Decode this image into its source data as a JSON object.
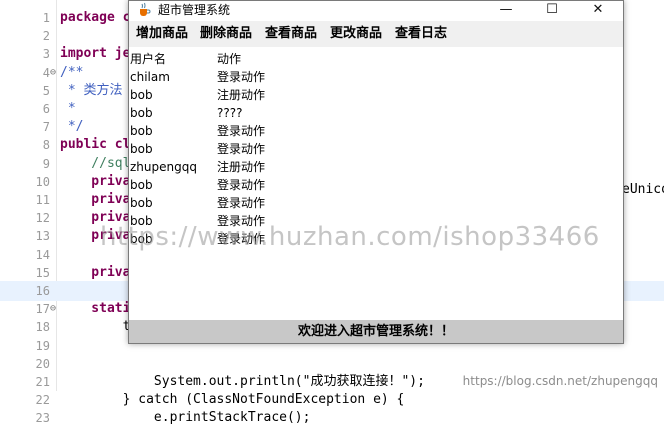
{
  "editor": {
    "lines": [
      {
        "num": "1",
        "fold": "",
        "text": "package c"
      },
      {
        "num": "2",
        "fold": "",
        "text": ""
      },
      {
        "num": "3",
        "fold": "",
        "text": "import je"
      },
      {
        "num": "4",
        "fold": "⊖",
        "text": "/**"
      },
      {
        "num": "5",
        "fold": "",
        "text": " * 类方法"
      },
      {
        "num": "6",
        "fold": "",
        "text": " *"
      },
      {
        "num": "7",
        "fold": "",
        "text": " */"
      },
      {
        "num": "8",
        "fold": "",
        "text": "public cl"
      },
      {
        "num": "9",
        "fold": "",
        "text": "    //sql"
      },
      {
        "num": "10",
        "fold": "",
        "text": "    priva"
      },
      {
        "num": "11",
        "fold": "",
        "text": "    priva"
      },
      {
        "num": "12",
        "fold": "",
        "text": "    priva"
      },
      {
        "num": "13",
        "fold": "",
        "text": "    priva"
      },
      {
        "num": "14",
        "fold": "",
        "text": ""
      },
      {
        "num": "15",
        "fold": "",
        "text": "    priva"
      },
      {
        "num": "16",
        "fold": "",
        "text": ""
      },
      {
        "num": "17",
        "fold": "⊖",
        "text": "    stati"
      },
      {
        "num": "18",
        "fold": "",
        "text": "        t"
      },
      {
        "num": "19",
        "fold": "",
        "text": ""
      },
      {
        "num": "20",
        "fold": "",
        "text": ""
      },
      {
        "num": "21",
        "fold": "",
        "text": "            System.out.println(\"成功获取连接！\");"
      },
      {
        "num": "22",
        "fold": "",
        "text": "        } catch (ClassNotFoundException e) {"
      },
      {
        "num": "23",
        "fold": "",
        "text": "            e.printStackTrace();"
      }
    ],
    "right_fragment": "eUnico"
  },
  "window": {
    "title": "超市管理系统",
    "minimize_glyph": "—",
    "maximize_glyph": "☐",
    "close_glyph": "✕",
    "menu": [
      "增加商品",
      "删除商品",
      "查看商品",
      "更改商品",
      "查看日志"
    ],
    "log_header": {
      "user": "用户名",
      "action": "动作"
    },
    "log_rows": [
      {
        "user": "chilam",
        "action": "登录动作"
      },
      {
        "user": "bob",
        "action": "注册动作"
      },
      {
        "user": "bob",
        "action": "????"
      },
      {
        "user": "bob",
        "action": "登录动作"
      },
      {
        "user": "bob",
        "action": "登录动作"
      },
      {
        "user": "zhupengqq",
        "action": "注册动作"
      },
      {
        "user": "bob",
        "action": "登录动作"
      },
      {
        "user": "bob",
        "action": "登录动作"
      },
      {
        "user": "bob",
        "action": "登录动作"
      },
      {
        "user": "bob",
        "action": "登录动作"
      }
    ],
    "status": "欢迎进入超市管理系统！！"
  },
  "watermark": "https://www.huzhan.com/ishop33466",
  "credit": "https://blog.csdn.net/zhupengqq"
}
